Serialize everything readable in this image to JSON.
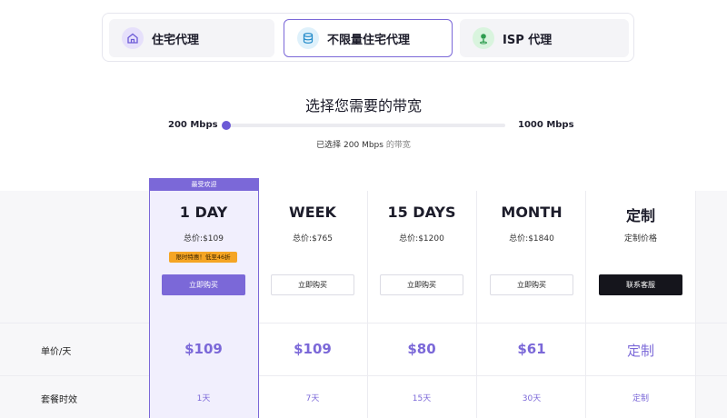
{
  "product_tabs": [
    {
      "label": "住宅代理",
      "icon": "home-icon"
    },
    {
      "label": "不限量住宅代理",
      "icon": "database-icon"
    },
    {
      "label": "ISP 代理",
      "icon": "location-pin-icon"
    }
  ],
  "bandwidth": {
    "title": "选择您需要的带宽",
    "min_label": "200 Mbps",
    "max_label": "1000 Mbps",
    "slider_level": 0,
    "selected_prefix": "已选择 200 Mbps",
    "selected_suffix": " 的带宽"
  },
  "pricing": {
    "popular_badge": "最受欢迎",
    "promo_badge": "限时特惠！低至46折",
    "row_labels": {
      "unit_price": "单价/天",
      "duration": "套餐时效"
    },
    "plans": [
      {
        "name": "1 DAY",
        "total": "总价:$109",
        "button": "立即购买",
        "unit_price": "$109",
        "duration": "1天"
      },
      {
        "name": "WEEK",
        "total": "总价:$765",
        "button": "立即购买",
        "unit_price": "$109",
        "duration": "7天"
      },
      {
        "name": "15 DAYS",
        "total": "总价:$1200",
        "button": "立即购买",
        "unit_price": "$80",
        "duration": "15天"
      },
      {
        "name": "MONTH",
        "total": "总价:$1840",
        "button": "立即购买",
        "unit_price": "$61",
        "duration": "30天"
      },
      {
        "name": "定制",
        "total": "定制价格",
        "button": "联系客服",
        "unit_price": "定制",
        "duration": "定制"
      }
    ]
  },
  "colors": {
    "accent": "#7b68d8",
    "promo": "#f5a524",
    "dark_button": "#15151c"
  }
}
